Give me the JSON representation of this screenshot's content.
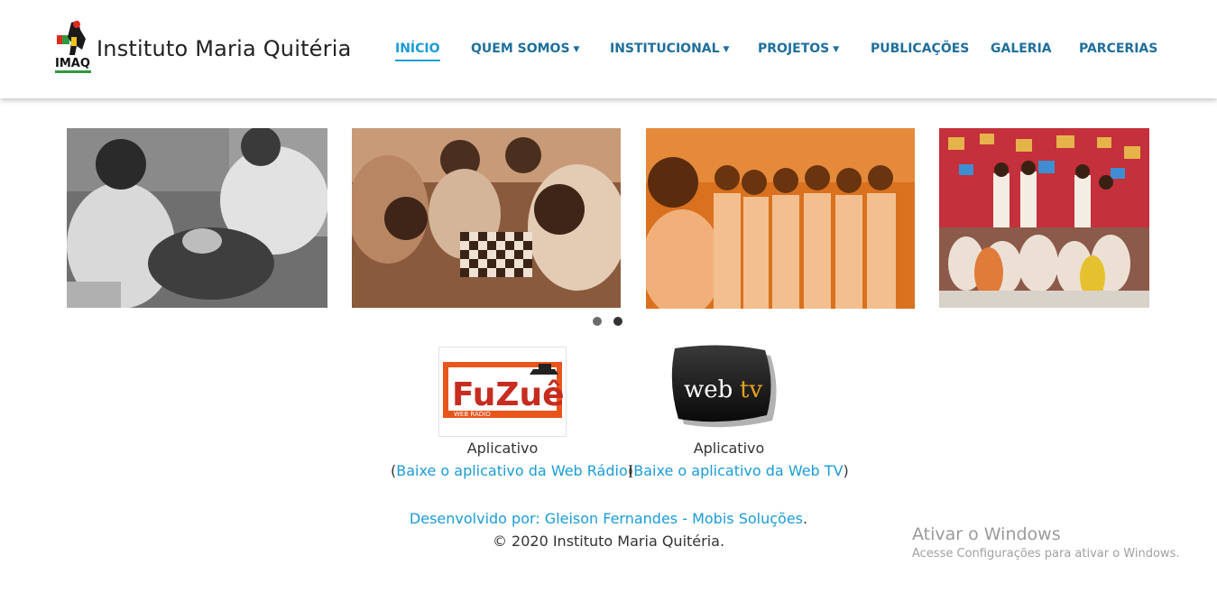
{
  "header": {
    "logo_text": "IMAQ",
    "brand": "Instituto Maria Quitéria"
  },
  "nav": {
    "items": [
      {
        "label": "INÍCIO",
        "dropdown": false,
        "active": true
      },
      {
        "label": "QUEM SOMOS",
        "dropdown": true,
        "active": false
      },
      {
        "label": "INSTITUCIONAL",
        "dropdown": true,
        "active": false
      },
      {
        "label": "PROJETOS",
        "dropdown": true,
        "active": false
      },
      {
        "label": "PUBLICAÇÕES",
        "dropdown": false,
        "active": false
      },
      {
        "label": "GALERIA",
        "dropdown": false,
        "active": false
      },
      {
        "label": "PARCERIAS",
        "dropdown": false,
        "active": false
      }
    ],
    "chevron": "⌄"
  },
  "carousel": {
    "slides": [
      {
        "name": "children-planting-photo",
        "tone": "grayscale"
      },
      {
        "name": "kids-playing-chess-photo",
        "tone": "sepia-orange"
      },
      {
        "name": "women-group-photo",
        "tone": "orange"
      },
      {
        "name": "group-performance-photo",
        "tone": "color"
      }
    ],
    "indicators": [
      {
        "active": false
      },
      {
        "active": true
      }
    ]
  },
  "apps": {
    "radio": {
      "logo_text": "FuZuê",
      "logo_sub": "WEB RÁDIO",
      "caption": "Aplicativo",
      "open_paren": "(",
      "link": "Baixe o aplicativo da Web Rádio",
      "close_paren": ")"
    },
    "tv": {
      "logo_text_a": "web",
      "logo_text_b": "tv",
      "caption": "Aplicativo",
      "open_paren": "(",
      "link": "Baixe o aplicativo da Web TV",
      "close_paren": ")"
    }
  },
  "footer": {
    "developer_link": "Desenvolvido por: Gleison Fernandes - Mobis Soluções",
    "developer_suffix": ".",
    "copyright": "© 2020 Instituto Maria Quitéria."
  },
  "windows_watermark": {
    "title": "Ativar o Windows",
    "subtitle": "Acesse Configurações para ativar o Windows."
  },
  "colors": {
    "nav_text": "#1f6f9c",
    "nav_active": "#1a9bd7",
    "link": "#1a9bd7",
    "fuzue_orange": "#e8561b",
    "fuzue_red": "#c62c1f"
  }
}
